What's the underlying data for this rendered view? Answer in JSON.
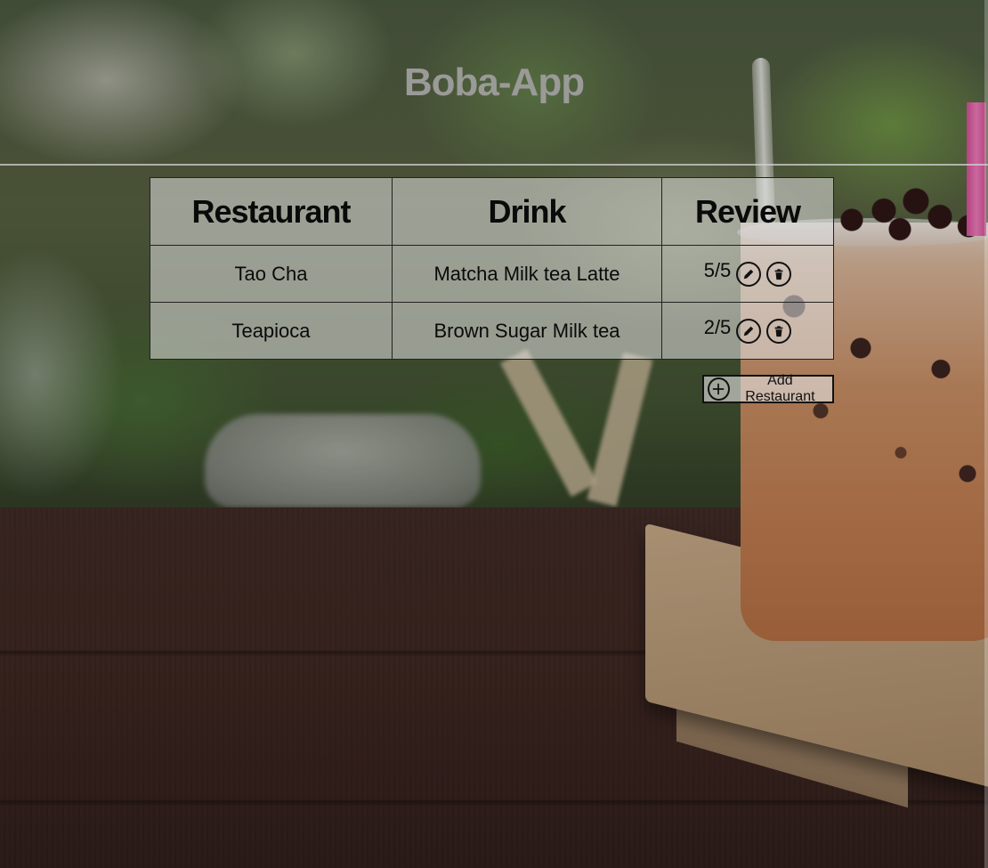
{
  "app": {
    "title": "Boba-App"
  },
  "table": {
    "headers": {
      "restaurant": "Restaurant",
      "drink": "Drink",
      "review": "Review"
    },
    "rows": [
      {
        "restaurant": "Tao Cha",
        "drink": "Matcha Milk tea Latte",
        "review": "5/5",
        "edit_icon": "pencil-icon",
        "delete_icon": "trash-icon"
      },
      {
        "restaurant": "Teapioca",
        "drink": "Brown Sugar Milk tea",
        "review": "2/5",
        "edit_icon": "pencil-icon",
        "delete_icon": "trash-icon"
      }
    ]
  },
  "actions": {
    "add_label": "Add Restaurant",
    "add_icon": "plus-circle-icon"
  },
  "colors": {
    "title": "#9a9a98",
    "table_bg": "rgba(225,225,225,0.55)",
    "border": "#222222"
  }
}
